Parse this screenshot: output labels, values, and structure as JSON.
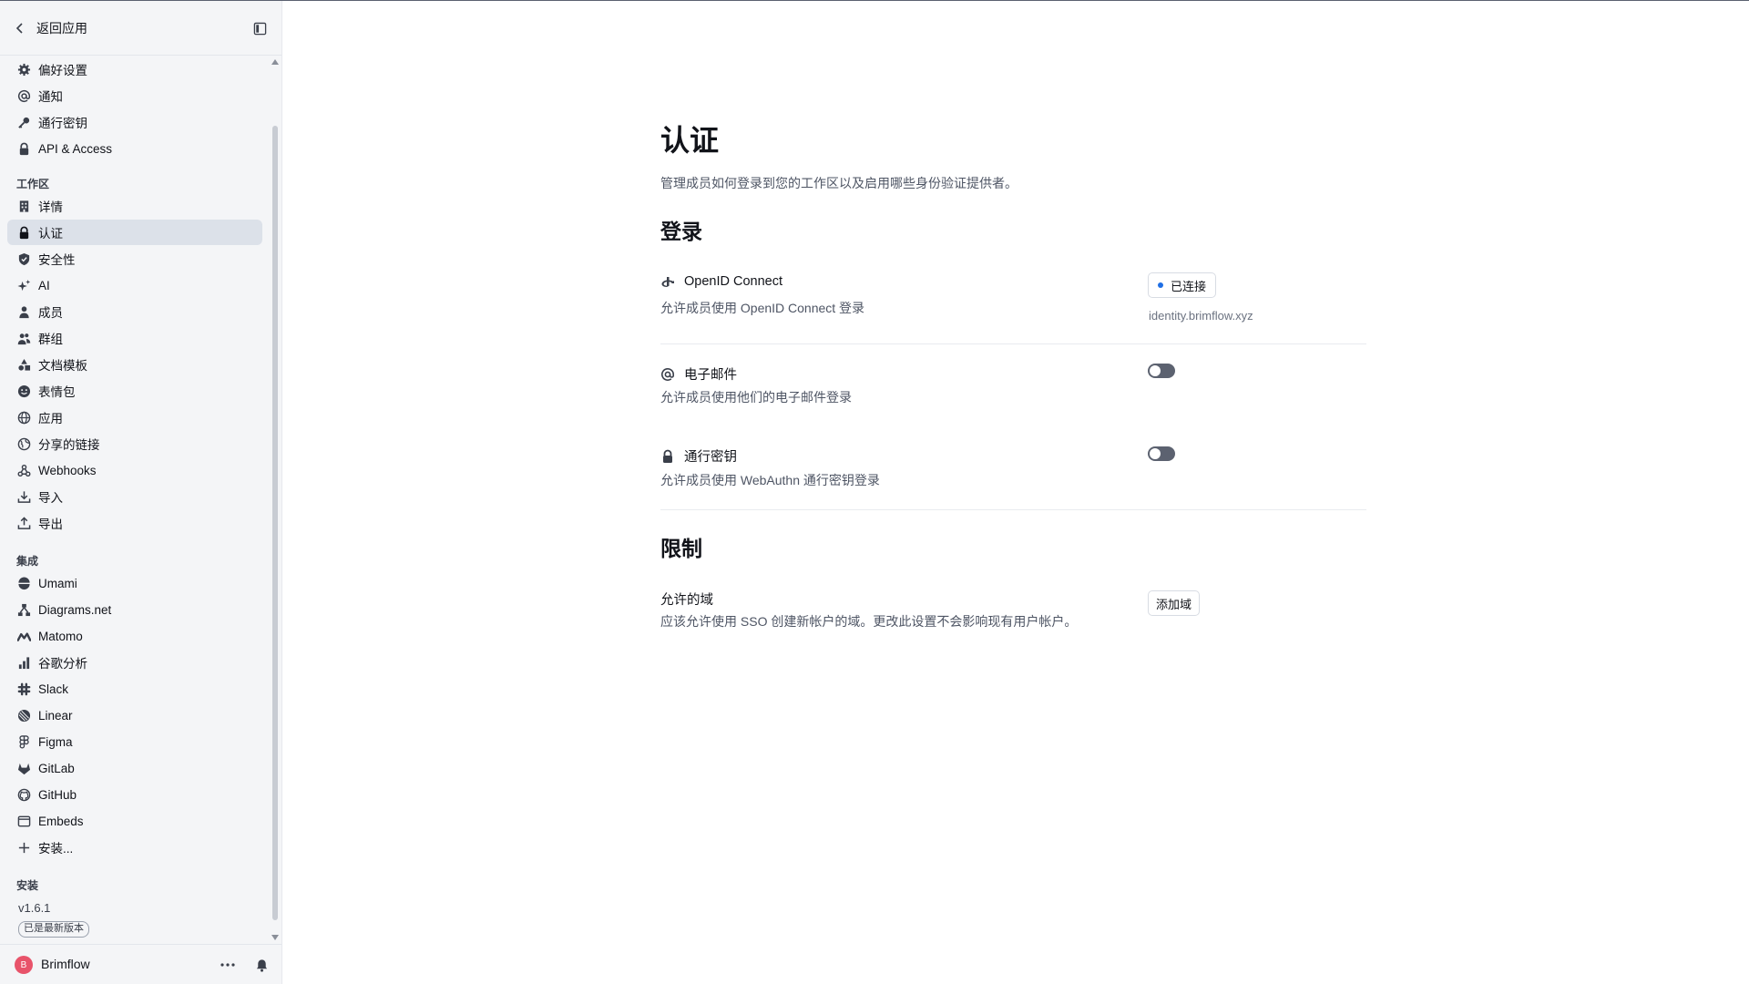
{
  "sidebar": {
    "back_label": "返回应用",
    "account_items": [
      {
        "label": "偏好设置",
        "icon": "gear-icon"
      },
      {
        "label": "通知",
        "icon": "at-icon"
      },
      {
        "label": "通行密钥",
        "icon": "key-icon"
      },
      {
        "label": "API & Access",
        "icon": "lock-icon"
      }
    ],
    "workspace_label": "工作区",
    "workspace_items": [
      {
        "label": "详情",
        "icon": "building-icon"
      },
      {
        "label": "认证",
        "icon": "lock-icon",
        "active": true
      },
      {
        "label": "安全性",
        "icon": "shield-icon"
      },
      {
        "label": "AI",
        "icon": "sparkle-icon"
      },
      {
        "label": "成员",
        "icon": "user-icon"
      },
      {
        "label": "群组",
        "icon": "users-icon"
      },
      {
        "label": "文档模板",
        "icon": "shapes-icon"
      },
      {
        "label": "表情包",
        "icon": "smiley-icon"
      },
      {
        "label": "应用",
        "icon": "globe-icon"
      },
      {
        "label": "分享的链接",
        "icon": "globe-link-icon"
      },
      {
        "label": "Webhooks",
        "icon": "webhook-icon"
      },
      {
        "label": "导入",
        "icon": "import-icon"
      },
      {
        "label": "导出",
        "icon": "export-icon"
      }
    ],
    "integrations_label": "集成",
    "integration_items": [
      {
        "label": "Umami",
        "icon": "umami-icon"
      },
      {
        "label": "Diagrams.net",
        "icon": "diagrams-icon"
      },
      {
        "label": "Matomo",
        "icon": "matomo-icon"
      },
      {
        "label": "谷歌分析",
        "icon": "bar-chart-icon"
      },
      {
        "label": "Slack",
        "icon": "slack-icon"
      },
      {
        "label": "Linear",
        "icon": "linear-icon"
      },
      {
        "label": "Figma",
        "icon": "figma-icon"
      },
      {
        "label": "GitLab",
        "icon": "gitlab-icon"
      },
      {
        "label": "GitHub",
        "icon": "github-icon"
      },
      {
        "label": "Embeds",
        "icon": "embed-icon"
      },
      {
        "label": "安装...",
        "icon": "plus-icon"
      }
    ],
    "install_label": "安装",
    "version": "v1.6.1",
    "version_badge": "已是最新版本",
    "workspace_name": "Brimflow",
    "avatar_letter": "B"
  },
  "main": {
    "title": "认证",
    "description": "管理成员如何登录到您的工作区以及启用哪些身份验证提供者。",
    "login_heading": "登录",
    "oidc": {
      "title": "OpenID Connect",
      "description": "允许成员使用 OpenID Connect 登录",
      "status": "已连接",
      "domain": "identity.brimflow.xyz"
    },
    "email": {
      "title": "电子邮件",
      "description": "允许成员使用他们的电子邮件登录"
    },
    "passkey": {
      "title": "通行密钥",
      "description": "允许成员使用 WebAuthn 通行密钥登录"
    },
    "restrictions_heading": "限制",
    "allowed_domains": {
      "title": "允许的域",
      "description": "应该允许使用 SSO 创建新帐户的域。更改此设置不会影响现有用户帐户。",
      "button": "添加域"
    }
  },
  "colors": {
    "sidebar_bg": "#f4f5f7",
    "active_item_bg": "#dce1e9",
    "status_dot": "#1f6fe5",
    "toggle_off": "#5c6270",
    "avatar": "#e8536a"
  }
}
